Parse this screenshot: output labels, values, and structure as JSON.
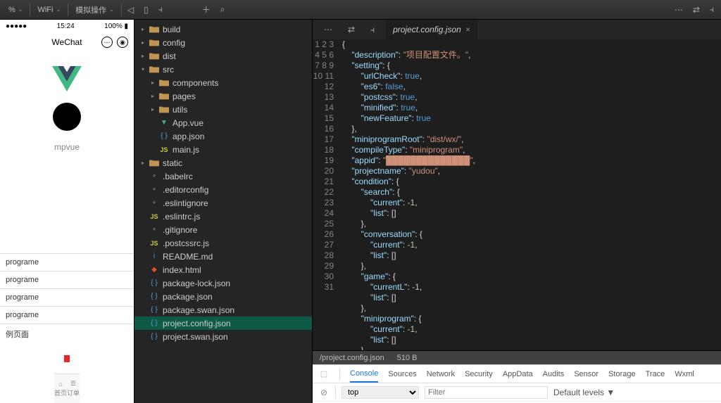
{
  "topbar": {
    "wifi": "WiFi",
    "sim": "模拟操作"
  },
  "simulator": {
    "time": "15:24",
    "battery": "100%",
    "title": "WeChat",
    "mp_label": "mpvue",
    "list_items": [
      "programe",
      "programe",
      "programe",
      "programe",
      "例页面"
    ],
    "tab1": "首页",
    "tab2": "订单"
  },
  "explorer": {
    "items": [
      {
        "d": 0,
        "t": "folder",
        "n": "build",
        "e": false
      },
      {
        "d": 0,
        "t": "folder",
        "n": "config",
        "e": false
      },
      {
        "d": 0,
        "t": "folder",
        "n": "dist",
        "e": false
      },
      {
        "d": 0,
        "t": "folder",
        "n": "src",
        "e": true
      },
      {
        "d": 1,
        "t": "folder",
        "n": "components",
        "e": false
      },
      {
        "d": 1,
        "t": "folder",
        "n": "pages",
        "e": false
      },
      {
        "d": 1,
        "t": "folder",
        "n": "utils",
        "e": false
      },
      {
        "d": 1,
        "t": "vue",
        "n": "App.vue"
      },
      {
        "d": 1,
        "t": "json",
        "n": "app.json"
      },
      {
        "d": 1,
        "t": "js",
        "n": "main.js"
      },
      {
        "d": 0,
        "t": "folder",
        "n": "static",
        "e": false
      },
      {
        "d": 0,
        "t": "file",
        "n": ".babelrc"
      },
      {
        "d": 0,
        "t": "file",
        "n": ".editorconfig"
      },
      {
        "d": 0,
        "t": "file",
        "n": ".eslintignore"
      },
      {
        "d": 0,
        "t": "js",
        "n": ".eslintrc.js"
      },
      {
        "d": 0,
        "t": "file",
        "n": ".gitignore"
      },
      {
        "d": 0,
        "t": "js",
        "n": ".postcssrc.js"
      },
      {
        "d": 0,
        "t": "md",
        "n": "README.md"
      },
      {
        "d": 0,
        "t": "html",
        "n": "index.html"
      },
      {
        "d": 0,
        "t": "json",
        "n": "package-lock.json"
      },
      {
        "d": 0,
        "t": "json",
        "n": "package.json"
      },
      {
        "d": 0,
        "t": "json",
        "n": "package.swan.json"
      },
      {
        "d": 0,
        "t": "json",
        "n": "project.config.json",
        "sel": true
      },
      {
        "d": 0,
        "t": "json",
        "n": "project.swan.json"
      }
    ]
  },
  "editor": {
    "tab": "project.config.json",
    "status_path": "/project.config.json",
    "status_size": "510 B",
    "lines": [
      {
        "n": 1,
        "h": "<span class='s-punc'>{</span>"
      },
      {
        "n": 2,
        "h": "    <span class='s-key'>\"description\"</span>: <span class='s-str'>\"项目配置文件。\"</span>,"
      },
      {
        "n": 3,
        "h": "    <span class='s-key'>\"setting\"</span>: {"
      },
      {
        "n": 4,
        "h": "        <span class='s-key'>\"urlCheck\"</span>: <span class='s-bool'>true</span>,"
      },
      {
        "n": 5,
        "h": "        <span class='s-key'>\"es6\"</span>: <span class='s-bool'>false</span>,"
      },
      {
        "n": 6,
        "h": "        <span class='s-key'>\"postcss\"</span>: <span class='s-bool'>true</span>,"
      },
      {
        "n": 7,
        "h": "        <span class='s-key'>\"minified\"</span>: <span class='s-bool'>true</span>,"
      },
      {
        "n": 8,
        "h": "        <span class='s-key'>\"newFeature\"</span>: <span class='s-bool'>true</span>"
      },
      {
        "n": 9,
        "h": "    },"
      },
      {
        "n": 10,
        "h": "    <span class='s-key'>\"miniprogramRoot\"</span>: <span class='s-str'>\"dist/wx/\"</span>,"
      },
      {
        "n": 11,
        "h": "    <span class='s-key'>\"compileType\"</span>: <span class='s-str'>\"miniprogram\"</span>,"
      },
      {
        "n": 12,
        "h": "    <span class='s-key'>\"appid\"</span>: <span class='s-str'>\"██████████████\"</span>,"
      },
      {
        "n": 13,
        "h": "    <span class='s-key'>\"projectname\"</span>: <span class='s-str'>\"yudou\"</span>,"
      },
      {
        "n": 14,
        "h": "    <span class='s-key'>\"condition\"</span>: {"
      },
      {
        "n": 15,
        "h": "        <span class='s-key'>\"search\"</span>: {"
      },
      {
        "n": 16,
        "h": "            <span class='s-key'>\"current\"</span>: <span class='s-num'>-1</span>,"
      },
      {
        "n": 17,
        "h": "            <span class='s-key'>\"list\"</span>: []"
      },
      {
        "n": 18,
        "h": "        },"
      },
      {
        "n": 19,
        "h": "        <span class='s-key'>\"conversation\"</span>: {"
      },
      {
        "n": 20,
        "h": "            <span class='s-key'>\"current\"</span>: <span class='s-num'>-1</span>,"
      },
      {
        "n": 21,
        "h": "            <span class='s-key'>\"list\"</span>: []"
      },
      {
        "n": 22,
        "h": "        },"
      },
      {
        "n": 23,
        "h": "        <span class='s-key'>\"game\"</span>: {"
      },
      {
        "n": 24,
        "h": "            <span class='s-key'>\"currentL\"</span>: <span class='s-num'>-1</span>,"
      },
      {
        "n": 25,
        "h": "            <span class='s-key'>\"list\"</span>: []"
      },
      {
        "n": 26,
        "h": "        },"
      },
      {
        "n": 27,
        "h": "        <span class='s-key'>\"miniprogram\"</span>: {"
      },
      {
        "n": 28,
        "h": "            <span class='s-key'>\"current\"</span>: <span class='s-num'>-1</span>,"
      },
      {
        "n": 29,
        "h": "            <span class='s-key'>\"list\"</span>: []"
      },
      {
        "n": 30,
        "h": "        }"
      },
      {
        "n": 31,
        "h": "    }"
      }
    ]
  },
  "devtools": {
    "tabs": [
      "Console",
      "Sources",
      "Network",
      "Security",
      "AppData",
      "Audits",
      "Sensor",
      "Storage",
      "Trace",
      "Wxml"
    ],
    "context": "top",
    "filter_ph": "Filter",
    "levels": "Default levels ▼"
  }
}
